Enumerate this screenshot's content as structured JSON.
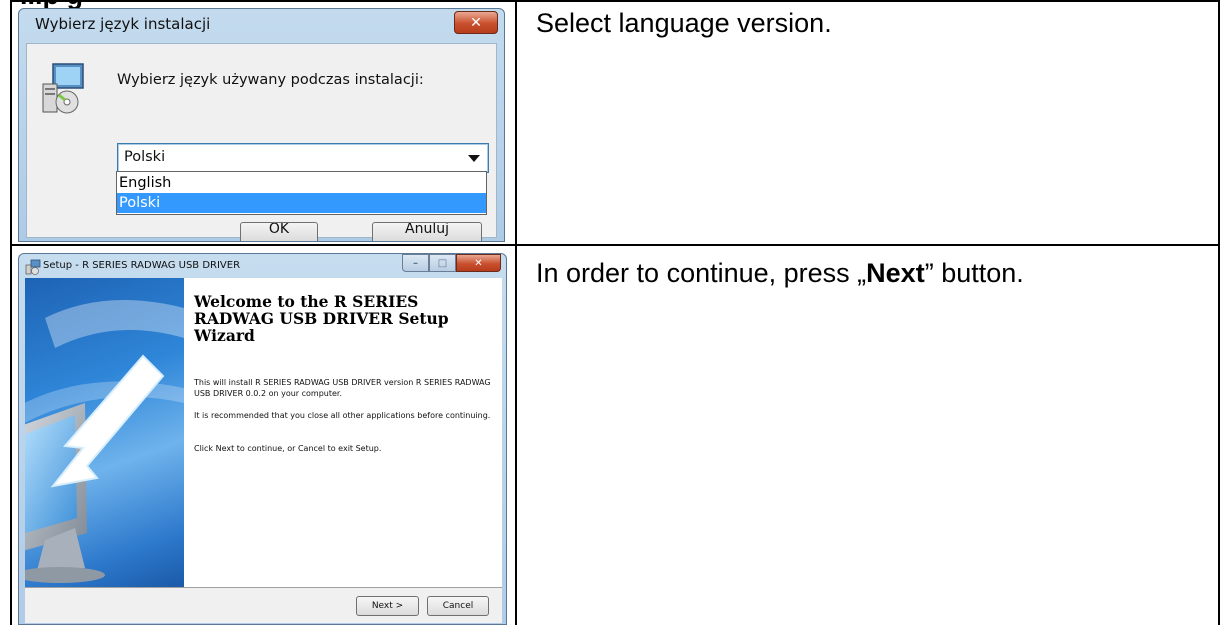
{
  "heading_fragment": "...p  g",
  "row1": {
    "description": "Select language version.",
    "dialog": {
      "title": "Wybierz język instalacji",
      "close_glyph": "✕",
      "prompt": "Wybierz język używany podczas instalacji:",
      "language_select": {
        "selected": "Polski",
        "options": [
          "English",
          "Polski"
        ],
        "highlighted": "Polski"
      },
      "ok_label": "OK",
      "cancel_label": "Anuluj"
    }
  },
  "row2": {
    "description_pre": "In order to continue, press „",
    "description_bold": "Next",
    "description_post": "” button.",
    "wizard": {
      "title": "Setup - R SERIES RADWAG USB DRIVER",
      "heading": "Welcome to the R SERIES RADWAG USB DRIVER Setup Wizard",
      "paragraph1": "This will install R SERIES RADWAG USB DRIVER version R SERIES RADWAG USB DRIVER 0.0.2 on your computer.",
      "paragraph2": "It is recommended that you close all other applications before continuing.",
      "paragraph3": "Click Next to continue, or Cancel to exit Setup.",
      "next_label": "Next >",
      "cancel_label": "Cancel",
      "close_glyph": "✕",
      "minimize_glyph": "–",
      "maximize_glyph": "□"
    }
  },
  "colors": {
    "selection": "#3399ff",
    "close_red": "#c9502e",
    "wizard_blue": "#2f86d8"
  }
}
